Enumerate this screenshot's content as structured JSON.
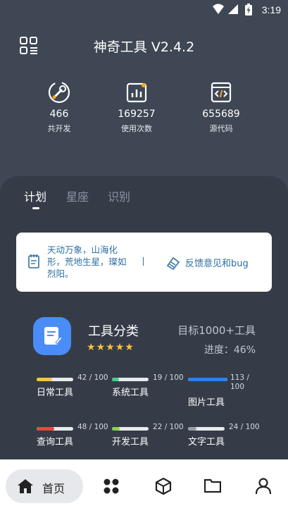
{
  "status_bar": {
    "time": "3:19"
  },
  "header": {
    "title": "神奇工具 V2.4.2"
  },
  "stats": [
    {
      "value": "466",
      "label": "共开发",
      "icon": "wrench-gear-icon"
    },
    {
      "value": "169257",
      "label": "使用次数",
      "icon": "bar-chart-icon"
    },
    {
      "value": "655689",
      "label": "源代码",
      "icon": "code-window-icon"
    }
  ],
  "tabs": [
    {
      "label": "计划",
      "active": true
    },
    {
      "label": "星座",
      "active": false
    },
    {
      "label": "识别",
      "active": false
    }
  ],
  "quote_card": {
    "quote": "天动万象，山海化形，荒地生星，璨如烈阳。",
    "separator": "|",
    "feedback_label": "反馈意见和bug"
  },
  "category": {
    "title": "工具分类",
    "rating": 5,
    "goal": "目标1000+工具",
    "progress_label": "进度：46%",
    "progress": 0.46
  },
  "tools": [
    {
      "name": "日常工具",
      "count": "42 / 100",
      "value": 42,
      "color": "#f5c542"
    },
    {
      "name": "系统工具",
      "count": "19 / 100",
      "value": 19,
      "color": "#3fcf8e"
    },
    {
      "name": "图片工具",
      "count": "113 / 100",
      "value": 100,
      "color": "#2f80ed"
    },
    {
      "name": "查询工具",
      "count": "48 / 100",
      "value": 48,
      "color": "#e64a3b"
    },
    {
      "name": "开发工具",
      "count": "22 / 100",
      "value": 22,
      "color": "#8bd14a"
    },
    {
      "name": "文字工具",
      "count": "24 / 100",
      "value": 24,
      "color": "#9aa0a8"
    }
  ],
  "bottom_nav": {
    "home_label": "首页",
    "items": [
      "home-icon",
      "grid-icon",
      "cube-icon",
      "folder-icon",
      "person-icon"
    ]
  }
}
